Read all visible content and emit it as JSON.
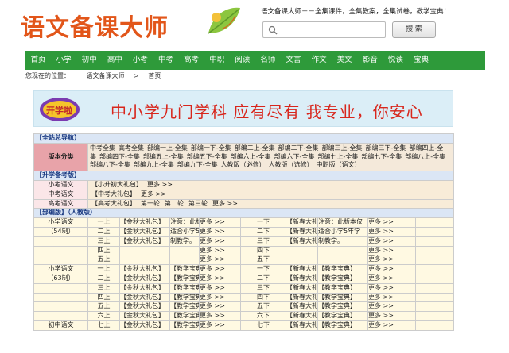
{
  "header": {
    "logo_text": "语文备课大师",
    "tagline": "语文备课大师－－全集课件，全集教案，全集试卷，教学宝典！",
    "search_placeholder": "",
    "search_button": "搜 索"
  },
  "nav": [
    "首页",
    "小学",
    "初中",
    "高中",
    "小考",
    "中考",
    "高考",
    "中职",
    "阅读",
    "名师",
    "文言",
    "作文",
    "美文",
    "影音",
    "悦读",
    "宝典"
  ],
  "breadcrumb": {
    "label": "您现在的位置：",
    "items": [
      "语文备课大师",
      "首页"
    ]
  },
  "banner": {
    "slogan": "中小学九门学科 应有尽有  我专业，你安心",
    "logo_text": "开学啦"
  },
  "overview": {
    "title": "【全站总导航】",
    "category": "版本分类",
    "items": [
      "中考全集",
      "高考全集",
      "部编一上-全集",
      "部编一下-全集",
      "部编二上-全集",
      "部编二下-全集",
      "部编三上-全集",
      "部编三下-全集",
      "部编四上-全集",
      "部编四下-全集",
      "部编五上-全集",
      "部编五下-全集",
      "部编六上-全集",
      "部编六下-全集",
      "部编七上-全集",
      "部编七下-全集",
      "部编八上-全集",
      "部编八下-全集",
      "部编九上-全集",
      "部编九下-全集",
      "人教版（必修）",
      "人教版（选修）",
      "中职版（语文）"
    ]
  },
  "upgrade": {
    "title": "【升学备考版】",
    "rows": [
      {
        "name": "小考语文",
        "items": [
          "【小升初大礼包】",
          "更多 >>"
        ]
      },
      {
        "name": "中考语文",
        "items": [
          "【中考大礼包】",
          "更多 >>"
        ]
      },
      {
        "name": "高考语文",
        "items": [
          "【高考大礼包】",
          "第一轮",
          "第二轮",
          "第三轮",
          "更多 >>"
        ]
      }
    ]
  },
  "bubian": {
    "title": "【部编版】（人教版）",
    "rows": [
      {
        "name": "小学语文",
        "a_grade": "一上",
        "a_pack": "【金秋大礼包】",
        "a_note": "注意：此版本仅",
        "a_more": "更多 >>",
        "b_grade": "一下",
        "b_pack": "【新春大礼包】",
        "b_note": "注意：此版本仅",
        "b_more": "更多 >>"
      },
      {
        "name": "（54制）",
        "a_grade": "二上",
        "a_pack": "【金秋大礼包】",
        "a_note": "适合小学5年学",
        "a_more": "更多 >>",
        "b_grade": "二下",
        "b_pack": "【新春大礼包】",
        "b_note": "适合小学5年学",
        "b_more": "更多 >>"
      },
      {
        "name": "",
        "a_grade": "三上",
        "a_pack": "【金秋大礼包】",
        "a_note": "制教学。",
        "a_more": "更多 >>",
        "b_grade": "三下",
        "b_pack": "【新春大礼包】",
        "b_note": "制教学。",
        "b_more": "更多 >>"
      },
      {
        "name": "",
        "a_grade": "四上",
        "a_pack": "",
        "a_note": "",
        "a_more": "更多 >>",
        "b_grade": "四下",
        "b_pack": "",
        "b_note": "",
        "b_more": "更多 >>"
      },
      {
        "name": "",
        "a_grade": "五上",
        "a_pack": "",
        "a_note": "",
        "a_more": "更多 >>",
        "b_grade": "五下",
        "b_pack": "",
        "b_note": "",
        "b_more": "更多 >>"
      },
      {
        "name": "小学语文",
        "a_grade": "一上",
        "a_pack": "【金秋大礼包】",
        "a_note": "【教学宝典】",
        "a_more": "更多 >>",
        "b_grade": "一下",
        "b_pack": "【新春大礼包】",
        "b_note": "【教学宝典】",
        "b_more": "更多 >>"
      },
      {
        "name": "（63制）",
        "a_grade": "二上",
        "a_pack": "【金秋大礼包】",
        "a_note": "【教学宝典】",
        "a_more": "更多 >>",
        "b_grade": "二下",
        "b_pack": "【新春大礼包】",
        "b_note": "【教学宝典】",
        "b_more": "更多 >>"
      },
      {
        "name": "",
        "a_grade": "三上",
        "a_pack": "【金秋大礼包】",
        "a_note": "【教学宝典】",
        "a_more": "更多 >>",
        "b_grade": "三下",
        "b_pack": "【新春大礼包】",
        "b_note": "【教学宝典】",
        "b_more": "更多 >>"
      },
      {
        "name": "",
        "a_grade": "四上",
        "a_pack": "【金秋大礼包】",
        "a_note": "【教学宝典】",
        "a_more": "更多 >>",
        "b_grade": "四下",
        "b_pack": "【新春大礼包】",
        "b_note": "【教学宝典】",
        "b_more": "更多 >>"
      },
      {
        "name": "",
        "a_grade": "五上",
        "a_pack": "【金秋大礼包】",
        "a_note": "【教学宝典】",
        "a_more": "更多 >>",
        "b_grade": "五下",
        "b_pack": "【新春大礼包】",
        "b_note": "【教学宝典】",
        "b_more": "更多 >>"
      },
      {
        "name": "",
        "a_grade": "六上",
        "a_pack": "【金秋大礼包】",
        "a_note": "【教学宝典】",
        "a_more": "更多 >>",
        "b_grade": "六下",
        "b_pack": "【新春大礼包】",
        "b_note": "【教学宝典】",
        "b_more": "更多 >>"
      },
      {
        "name": "初中语文",
        "a_grade": "七上",
        "a_pack": "【金秋大礼包】",
        "a_note": "【教学宝典】",
        "a_more": "更多 >>",
        "b_grade": "七下",
        "b_pack": "【新春大礼包】",
        "b_note": "【教学宝典】",
        "b_more": "更多 >>"
      }
    ]
  },
  "colors": {
    "nav_bg": "#2e9a3a",
    "logo": "#e2561a",
    "slogan": "#d8261c",
    "section_head": "#dbe6f5",
    "category_cell": "#e8a3a9"
  }
}
